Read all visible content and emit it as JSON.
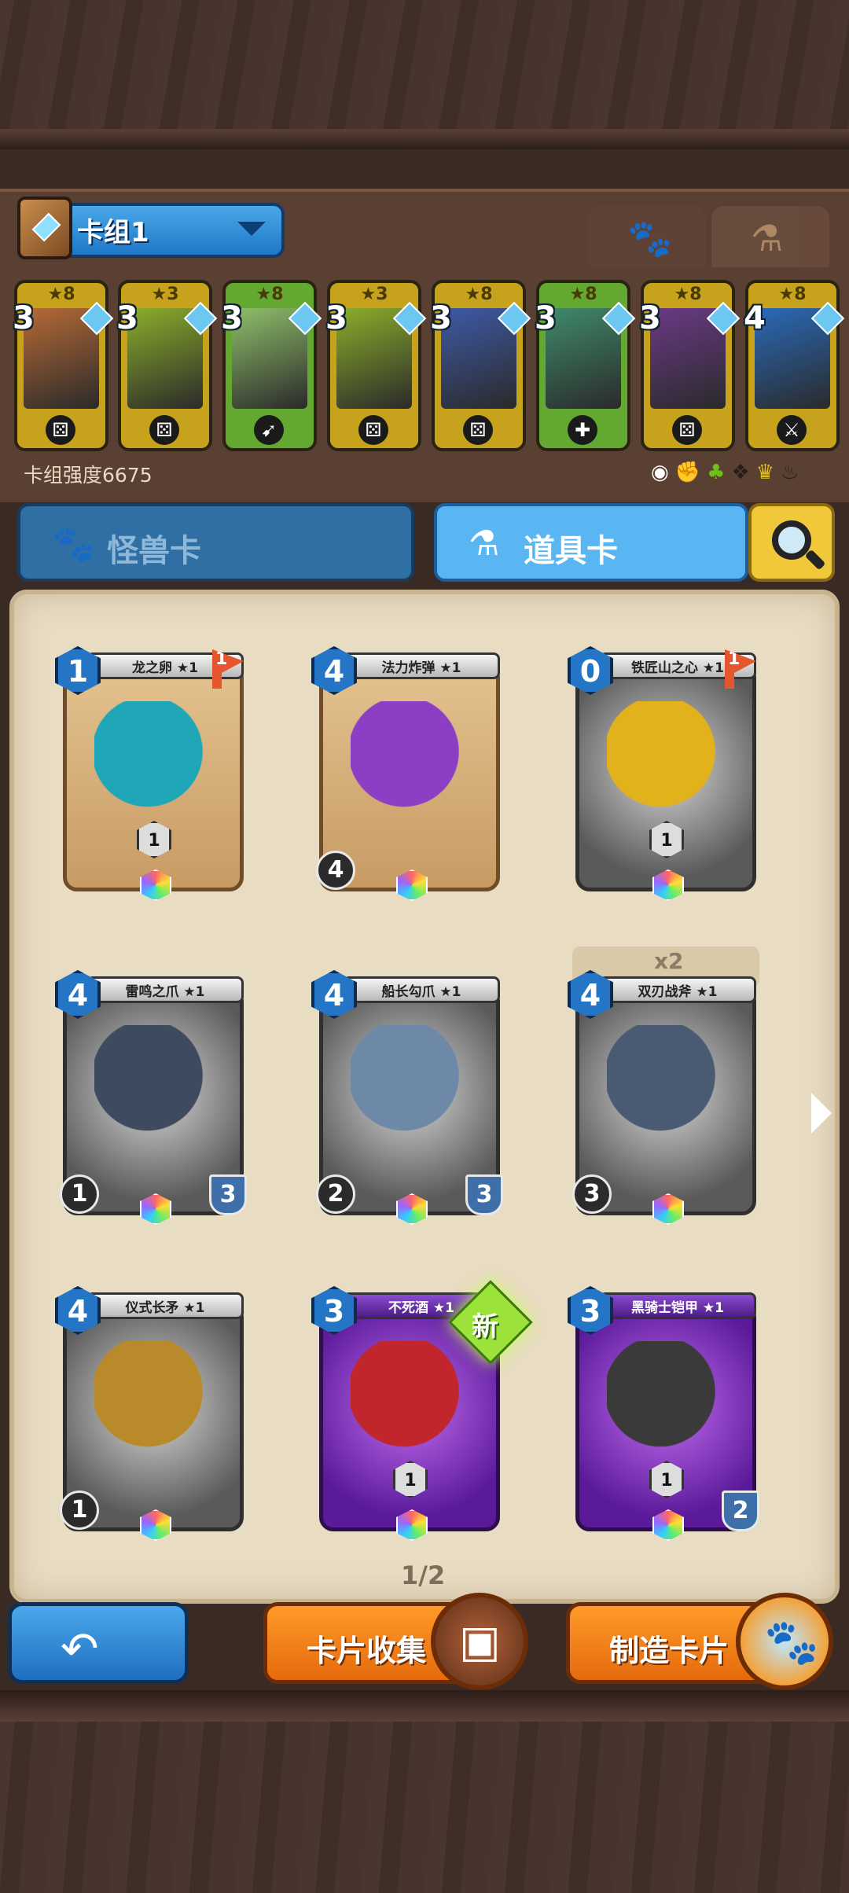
{
  "deck": {
    "name": "卡组1",
    "power_label": "卡组强度6675",
    "cards": [
      {
        "stars": "★8",
        "cost": "3",
        "badge": "⚄",
        "art": "#b66a36",
        "bg": "#c7a21d"
      },
      {
        "stars": "★3",
        "cost": "3",
        "badge": "⚄",
        "art": "#8cae2a",
        "bg": "#c7a21d"
      },
      {
        "stars": "★8",
        "cost": "3",
        "badge": "➹",
        "art": "#8fbf6a",
        "bg": "#62a831"
      },
      {
        "stars": "★3",
        "cost": "3",
        "badge": "⚄",
        "art": "#8cae2a",
        "bg": "#c7a21d"
      },
      {
        "stars": "★8",
        "cost": "3",
        "badge": "⚄",
        "art": "#3e5aa6",
        "bg": "#c7a21d"
      },
      {
        "stars": "★8",
        "cost": "3",
        "badge": "✚",
        "art": "#3f8a6a",
        "bg": "#62a831"
      },
      {
        "stars": "★8",
        "cost": "3",
        "badge": "⚄",
        "art": "#6a3a86",
        "bg": "#c7a21d"
      },
      {
        "stars": "★8",
        "cost": "4",
        "badge": "⚔",
        "art": "#2a6ab8",
        "bg": "#c7a21d"
      }
    ]
  },
  "tabs": {
    "monster_label": "怪兽卡",
    "item_label": "道具卡"
  },
  "cards": [
    {
      "name": "龙之卵 ★1",
      "cost": "1",
      "flag": "1",
      "style": "bronze",
      "art": "#1fa7b8",
      "tag": "1"
    },
    {
      "name": "法力炸弹 ★1",
      "cost": "4",
      "flag": "",
      "style": "bronze",
      "art": "#8c3fc4",
      "atk": "4"
    },
    {
      "name": "铁匠山之心 ★1",
      "cost": "0",
      "flag": "1",
      "style": "silver",
      "art": "#e2b21c",
      "tag": "1"
    },
    {
      "name": "雷鸣之爪 ★1",
      "cost": "4",
      "flag": "",
      "style": "silver",
      "art": "#3e4a5e",
      "atk": "1",
      "hp": "3"
    },
    {
      "name": "船长勾爪 ★1",
      "cost": "4",
      "flag": "",
      "style": "silver",
      "art": "#6e88a8",
      "atk": "2",
      "hp": "3"
    },
    {
      "name": "双刃战斧 ★1",
      "cost": "4",
      "flag": "",
      "style": "silver",
      "art": "#4a5a72",
      "atk": "3",
      "count": "x2"
    },
    {
      "name": "仪式长矛 ★1",
      "cost": "4",
      "flag": "",
      "style": "silver",
      "art": "#b98a2a",
      "atk": "1"
    },
    {
      "name": "不死酒 ★1",
      "cost": "3",
      "flag": "",
      "style": "purple",
      "art": "#c0262b",
      "tag": "1",
      "new": "新"
    },
    {
      "name": "黑骑士铠甲 ★1",
      "cost": "3",
      "flag": "",
      "style": "purple",
      "art": "#3a3a3a",
      "tag": "1",
      "hp": "2"
    }
  ],
  "pager": "1/2",
  "buttons": {
    "collect_label": "卡片收集",
    "craft_label": "制造卡片"
  }
}
